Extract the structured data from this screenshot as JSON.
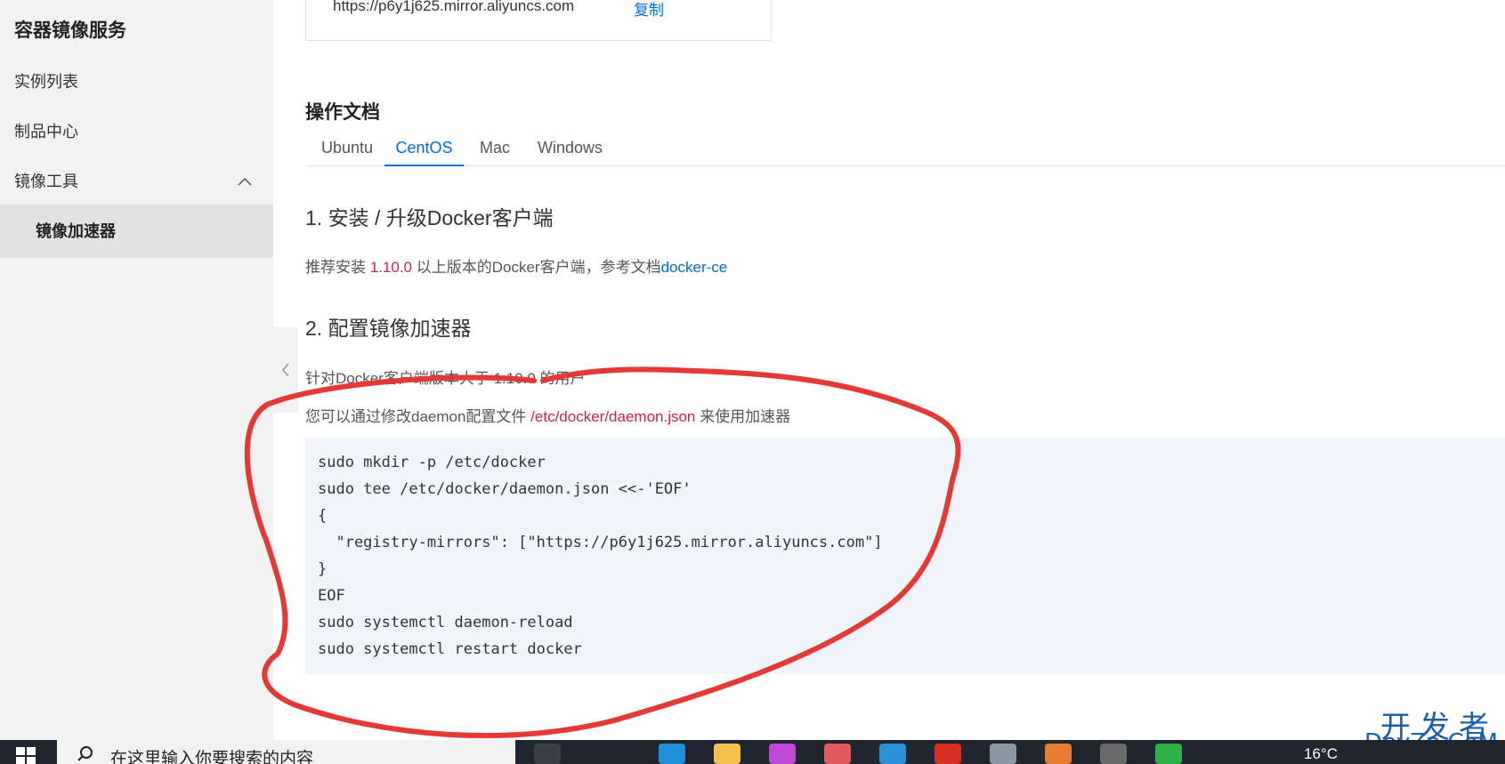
{
  "sidebar": {
    "title": "容器镜像服务",
    "items": [
      {
        "label": "实例列表"
      },
      {
        "label": "制品中心"
      },
      {
        "label": "镜像工具"
      },
      {
        "label": "镜像加速器"
      }
    ]
  },
  "accelerator": {
    "url": "https://p6y1j625.mirror.aliyuncs.com",
    "copy_label": "复制"
  },
  "docs": {
    "title": "操作文档",
    "tabs": [
      {
        "label": "Ubuntu"
      },
      {
        "label": "CentOS"
      },
      {
        "label": "Mac"
      },
      {
        "label": "Windows"
      }
    ],
    "active_tab": "CentOS",
    "step1": {
      "heading": "1. 安装 / 升级Docker客户端",
      "text_before": "推荐安装 ",
      "version": "1.10.0",
      "text_after": " 以上版本的Docker客户端，参考文档",
      "link": "docker-ce"
    },
    "step2": {
      "heading": "2. 配置镜像加速器",
      "line1": "针对Docker客户端版本大于 1.10.0 的用户",
      "line2_before": "您可以通过修改daemon配置文件 ",
      "path": "/etc/docker/daemon.json",
      "line2_after": " 来使用加速器"
    },
    "code": [
      "sudo mkdir -p /etc/docker",
      "sudo tee /etc/docker/daemon.json <<-'EOF'",
      "{",
      "  \"registry-mirrors\": [\"https://p6y1j625.mirror.aliyuncs.com\"]",
      "}",
      "EOF",
      "sudo systemctl daemon-reload",
      "sudo systemctl restart docker"
    ]
  },
  "watermark": {
    "top": "开发者",
    "bottom": "DevZe.CoM"
  },
  "taskbar": {
    "search_placeholder": "在这里输入你要搜索的内容",
    "temperature": "16°C"
  },
  "colors": {
    "accent": "#0070cc",
    "highlight": "#c7254e",
    "annotation": "#e53935",
    "sidebar_bg": "#f2f2f2",
    "code_bg": "#f1f5fb"
  }
}
